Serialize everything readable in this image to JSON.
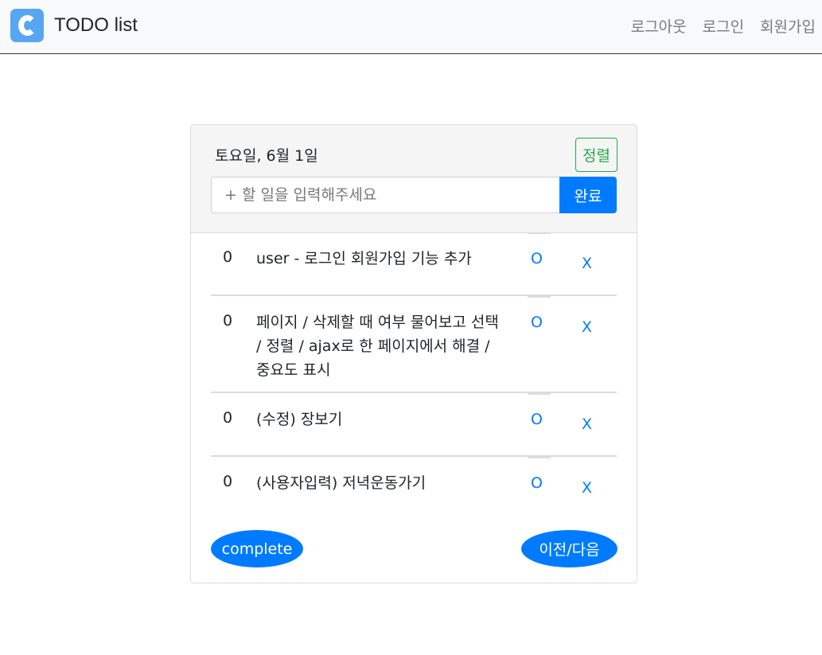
{
  "navbar": {
    "brand": "TODO list",
    "links": [
      "로그아웃",
      "로그인",
      "회원가입"
    ]
  },
  "card": {
    "date": "토요일, 6월 1일",
    "sort_label": "정렬",
    "input_placeholder": "+ 할 일을 입력해주세요",
    "input_value": "",
    "submit_label": "완료",
    "todos": [
      {
        "num": "0",
        "text": "user - 로그인 회원가입 기능 추가",
        "o": "O",
        "x": "X"
      },
      {
        "num": "0",
        "text": "페이지 / 삭제할 때 여부 물어보고 선택 / 정렬 / ajax로 한 페이지에서 해결 / 중요도 표시",
        "o": "O",
        "x": "X"
      },
      {
        "num": "0",
        "text": "(수정) 장보기",
        "o": "O",
        "x": "X"
      },
      {
        "num": "0",
        "text": "(사용자입력) 저녁운동가기",
        "o": "O",
        "x": "X"
      }
    ],
    "complete_label": "complete",
    "pager_label": "이전/다음"
  },
  "colors": {
    "primary": "#007bff",
    "success": "#28a745",
    "logo": "#58a6f2",
    "navbar_bg": "#f8f9fa"
  },
  "icons": {
    "logo": "c-logo-icon"
  }
}
